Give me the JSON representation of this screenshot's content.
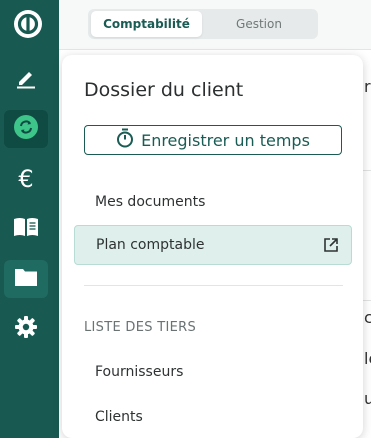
{
  "sidebar": {
    "items": [
      {
        "name": "edit",
        "icon": "pencil-icon"
      },
      {
        "name": "sync",
        "icon": "sync-icon"
      },
      {
        "name": "euro",
        "icon": "euro-icon"
      },
      {
        "name": "book",
        "icon": "book-icon"
      },
      {
        "name": "folder",
        "icon": "folder-icon"
      },
      {
        "name": "settings",
        "icon": "gear-icon"
      }
    ],
    "colors": {
      "background": "#185a52",
      "accent": "#3ec58a"
    }
  },
  "topbar": {
    "tabs": [
      {
        "label": "Comptabilité",
        "active": true
      },
      {
        "label": "Gestion",
        "active": false
      }
    ]
  },
  "background": {
    "fragments": [
      "re",
      "c",
      "le",
      "u"
    ]
  },
  "panel": {
    "title": "Dossier du client",
    "record_button_label": "Enregistrer un temps",
    "menu": [
      {
        "label": "Mes documents",
        "selected": false
      },
      {
        "label": "Plan comptable",
        "selected": true,
        "external": true
      }
    ],
    "section_label": "LISTE DES TIERS",
    "tiers": [
      {
        "label": "Fournisseurs"
      },
      {
        "label": "Clients"
      }
    ],
    "colors": {
      "primary": "#1a5c54",
      "selected_bg": "#dff0ec"
    }
  }
}
